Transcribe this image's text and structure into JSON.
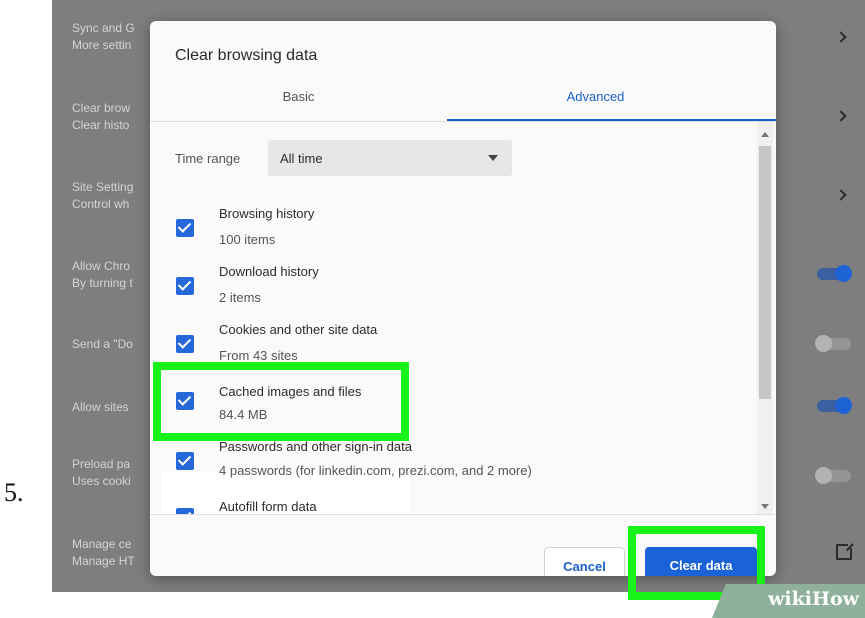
{
  "step_label": "5.",
  "background": {
    "rows": [
      {
        "title": "Sync and G",
        "subtitle": "More settin"
      },
      {
        "title": "Clear brow",
        "subtitle": "Clear histo"
      },
      {
        "title": "Site Setting",
        "subtitle": "Control wh"
      },
      {
        "title": "Allow Chro",
        "subtitle": "By turning t"
      },
      {
        "title": "Send a \"Do",
        "subtitle": ""
      },
      {
        "title": "Allow sites",
        "subtitle": ""
      },
      {
        "title": "Preload pa",
        "subtitle": "Uses cooki"
      },
      {
        "title": "Manage ce",
        "subtitle": "Manage HT"
      }
    ],
    "toggles": [
      "on",
      "off",
      "on",
      "off"
    ]
  },
  "dialog": {
    "title": "Clear browsing data",
    "tabs": [
      {
        "label": "Basic",
        "selected": false
      },
      {
        "label": "Advanced",
        "selected": true
      }
    ],
    "time_range": {
      "label": "Time range",
      "value": "All time"
    },
    "items": [
      {
        "title": "Browsing history",
        "subtitle": "100 items",
        "checked": true
      },
      {
        "title": "Download history",
        "subtitle": "2 items",
        "checked": true
      },
      {
        "title": "Cookies and other site data",
        "subtitle": "From 43 sites",
        "checked": true
      },
      {
        "title": "Cached images and files",
        "subtitle": "84.4 MB",
        "checked": true
      },
      {
        "title": "Passwords and other sign-in data",
        "subtitle": "4 passwords (for linkedin.com, prezi.com, and 2 more)",
        "checked": true
      },
      {
        "title": "Autofill form data",
        "subtitle": "",
        "checked": true
      }
    ],
    "buttons": {
      "cancel": "Cancel",
      "clear": "Clear data"
    }
  },
  "watermark": "wikiHow",
  "colors": {
    "accent": "#1a62d5",
    "highlight": "#18f318"
  }
}
